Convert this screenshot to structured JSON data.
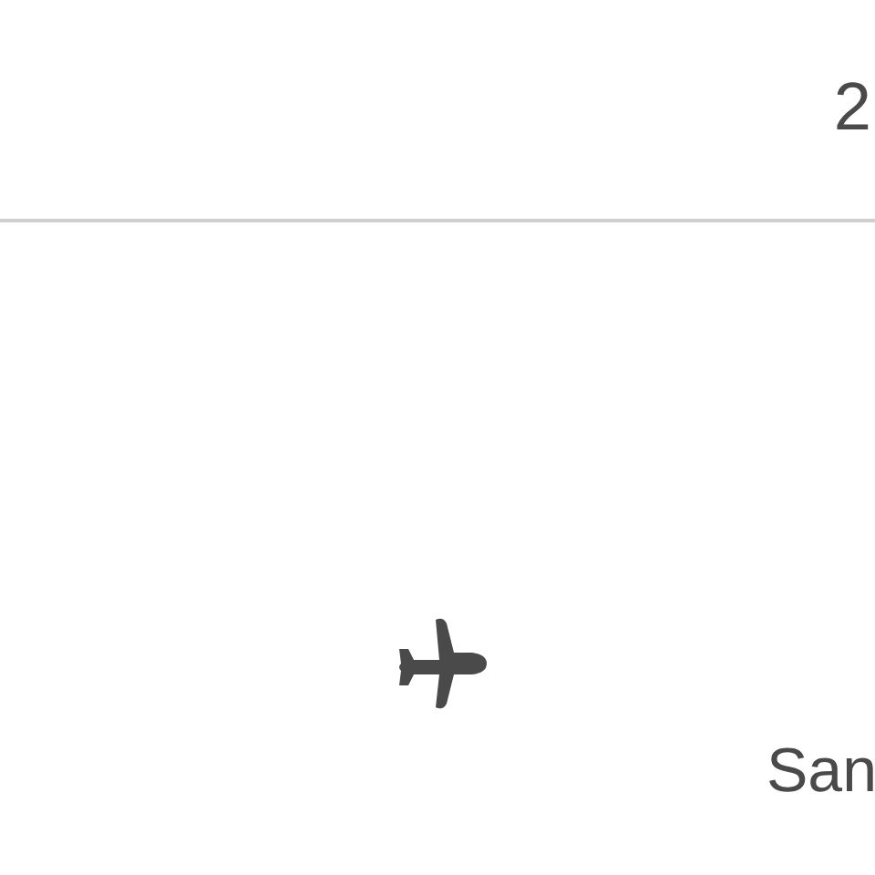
{
  "header": {
    "value": "2"
  },
  "flight": {
    "destination": "San"
  }
}
